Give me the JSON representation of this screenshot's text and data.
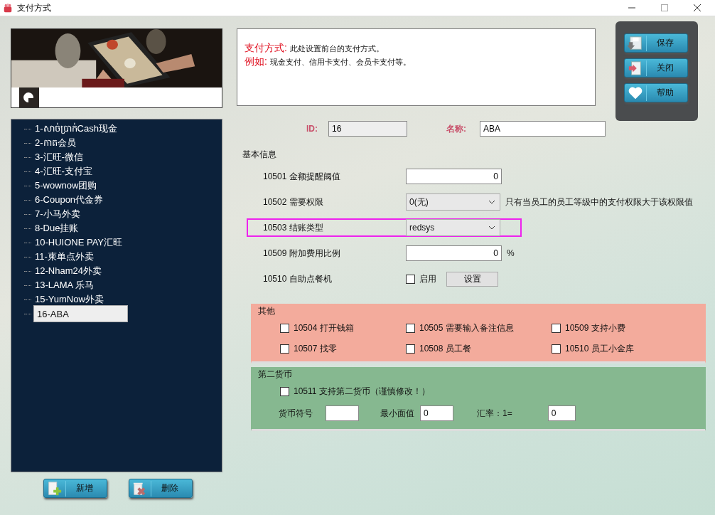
{
  "window": {
    "title": "支付方式"
  },
  "tree": {
    "items": [
      {
        "label": "1-សាច់ប្រាក់Cash现金",
        "selected": false
      },
      {
        "label": "2-កាត会员",
        "selected": false
      },
      {
        "label": "3-汇旺-微信",
        "selected": false
      },
      {
        "label": "4-汇旺-支付宝",
        "selected": false
      },
      {
        "label": "5-wownow团购",
        "selected": false
      },
      {
        "label": "6-Coupon代金券",
        "selected": false
      },
      {
        "label": "7-小马外卖",
        "selected": false
      },
      {
        "label": "8-Due挂账",
        "selected": false
      },
      {
        "label": "10-HUIONE PAY汇旺",
        "selected": false
      },
      {
        "label": "11-柬单点外卖",
        "selected": false
      },
      {
        "label": "12-Nham24外卖",
        "selected": false
      },
      {
        "label": "13-LAMA 乐马",
        "selected": false
      },
      {
        "label": "15-YumNow外卖",
        "selected": false
      },
      {
        "label": "16-ABA",
        "selected": true
      }
    ]
  },
  "side_buttons": [
    {
      "label": "新增",
      "kind": "add"
    },
    {
      "label": "删除",
      "kind": "delete"
    }
  ],
  "info": {
    "lines": [
      {
        "label": "支付方式:",
        "text": "此处设置前台的支付方式。"
      },
      {
        "label": "例如:",
        "text": "现金支付、信用卡支付、会员卡支付等。"
      }
    ]
  },
  "actions": [
    {
      "label": "保存",
      "kind": "save"
    },
    {
      "label": "关闭",
      "kind": "close"
    },
    {
      "label": "帮助",
      "kind": "help"
    }
  ],
  "id_field": {
    "label": "ID:",
    "value": "16"
  },
  "name_field": {
    "label": "名称:",
    "value": "ABA"
  },
  "basic": {
    "title": "基本信息",
    "rows": [
      {
        "kind": "input",
        "label": "10501 金额提醒阈值",
        "value": "0",
        "highlighted": false
      },
      {
        "kind": "select",
        "label": "10502 需要权限",
        "value": "0(无)",
        "note": "只有当员工的员工等级中的支付权限大于该权限值",
        "highlighted": false
      },
      {
        "kind": "select",
        "label": "10503 结账类型",
        "value": "redsys",
        "highlighted": true
      },
      {
        "kind": "input",
        "label": "10509 附加费用比例",
        "value": "0",
        "note": "%",
        "highlighted": false
      },
      {
        "kind": "checkbox",
        "label": "10510 自助点餐机",
        "check_label": "启用",
        "checked": false,
        "button": "设置",
        "highlighted": false
      }
    ]
  },
  "other": {
    "title": "其他",
    "checkboxes": [
      {
        "label": "10504 打开钱箱",
        "checked": false
      },
      {
        "label": "10505 需要输入备注信息",
        "checked": false
      },
      {
        "label": "10509 支持小费",
        "checked": false
      },
      {
        "label": "10507 找零",
        "checked": false
      },
      {
        "label": "10508 员工餐",
        "checked": false
      },
      {
        "label": "10510 员工小金库",
        "checked": false
      }
    ]
  },
  "currency": {
    "title": "第二货币",
    "checkbox": {
      "label": "10511 支持第二货币（谨慎修改！）",
      "checked": false
    },
    "fields": [
      {
        "label": "货币符号"
      },
      {
        "label": "最小面值",
        "value": "0"
      },
      {
        "label": "汇率：1=",
        "value": "0"
      }
    ]
  }
}
